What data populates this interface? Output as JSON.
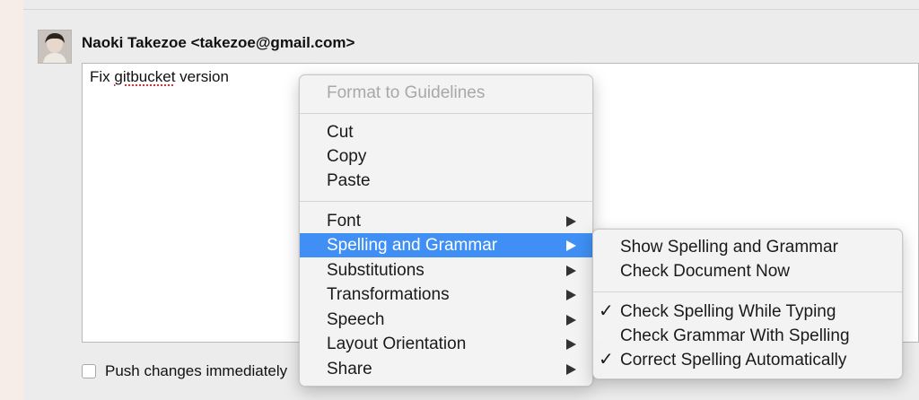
{
  "commit": {
    "author": "Naoki Takezoe <takezoe@gmail.com>",
    "message_before": "Fix ",
    "message_misspelled": "gitbucket",
    "message_after": " version",
    "push_label": "Push changes immediately"
  },
  "context_menu": {
    "format_label": "Format to Guidelines",
    "cut": "Cut",
    "copy": "Copy",
    "paste": "Paste",
    "font": "Font",
    "spelling": "Spelling and Grammar",
    "substitutions": "Substitutions",
    "transformations": "Transformations",
    "speech": "Speech",
    "layout_orientation": "Layout Orientation",
    "share": "Share"
  },
  "submenu": {
    "show_spelling": "Show Spelling and Grammar",
    "check_now": "Check Document Now",
    "check_while_typing": "Check Spelling While Typing",
    "check_grammar": "Check Grammar With Spelling",
    "correct_auto": "Correct Spelling Automatically",
    "checkmark": "✓"
  },
  "colors": {
    "highlight": "#3f8ff4",
    "spell_underline": "#e0302a"
  }
}
